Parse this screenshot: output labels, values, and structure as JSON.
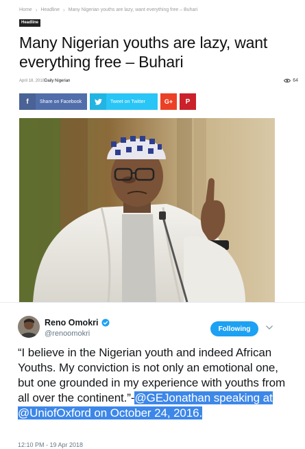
{
  "article": {
    "breadcrumb": [
      "Home",
      "Headline",
      "Many Nigerian youths are lazy, want everything free – Buhari"
    ],
    "category": "Headline",
    "title": "Many Nigerian youths are lazy, want everything free – Buhari",
    "date": "April 18, 2018",
    "author": "Daily Nigerian",
    "views": "64",
    "share": {
      "facebook_label": "Share on Facebook",
      "twitter_label": "Tweet on Twitter",
      "googleplus_label": "G+",
      "pinterest_label": "P",
      "facebook_glyph": "f"
    },
    "colors": {
      "facebook": "#516eab",
      "twitter": "#29c5f6",
      "googleplus": "#eb4026",
      "pinterest": "#ca212a"
    },
    "photo_icon": "photo-of-man-in-white-kaftan-and-cap"
  },
  "tweet": {
    "name": "Reno Omokri",
    "handle": "@renoomokri",
    "follow_label": "Following",
    "text_plain": "“I believe in the Nigerian youth and indeed African Youths. My conviction is not only an emotional one, but one grounded in my experience with youths from all over the continent.”-",
    "text_highlight": "@GEJonathan speaking at @UniofOxford on October 24, 2016.",
    "time": "12:10 PM - 19 Apr 2018",
    "accent": "#1da1f2"
  }
}
